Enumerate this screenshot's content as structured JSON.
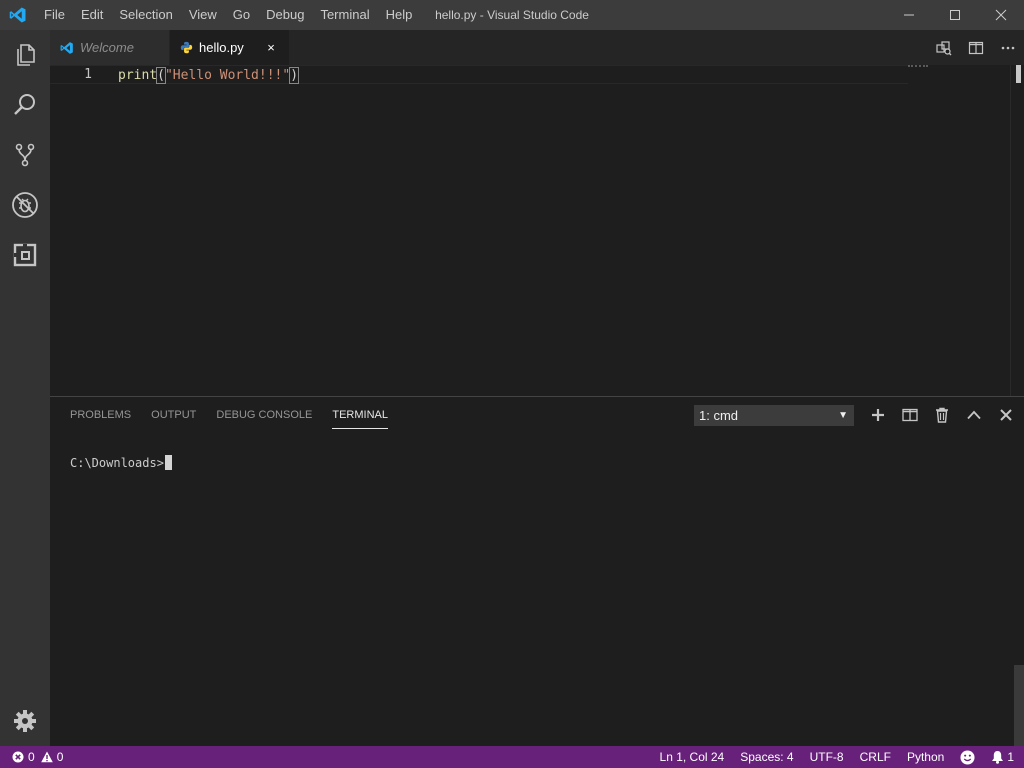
{
  "window": {
    "title": "hello.py - Visual Studio Code"
  },
  "menu": [
    "File",
    "Edit",
    "Selection",
    "View",
    "Go",
    "Debug",
    "Terminal",
    "Help"
  ],
  "activity_bar": [
    "files-icon",
    "search-icon",
    "source-control-icon",
    "debug-icon",
    "extensions-icon",
    "gear-icon"
  ],
  "tabs": [
    {
      "label": "Welcome",
      "active": false
    },
    {
      "label": "hello.py",
      "active": true,
      "close": "×"
    }
  ],
  "editor": {
    "line_number": "1",
    "tokens": {
      "fn": "print",
      "open": "(",
      "str": "\"Hello World!!!\"",
      "close": ")"
    }
  },
  "panel": {
    "tabs": [
      "PROBLEMS",
      "OUTPUT",
      "DEBUG CONSOLE",
      "TERMINAL"
    ],
    "active_tab": "TERMINAL",
    "terminal_select": "1: cmd",
    "terminal_prompt": "C:\\Downloads>"
  },
  "statusbar": {
    "errors": "0",
    "warnings": "0",
    "position": "Ln 1, Col 24",
    "spaces": "Spaces: 4",
    "encoding": "UTF-8",
    "eol": "CRLF",
    "language": "Python",
    "notifications": "1"
  },
  "colors": {
    "statusbar": "#68217a",
    "vscode_blue": "#23a9f2",
    "python_blue": "#3a7bbf",
    "python_yellow": "#ffd43b"
  }
}
